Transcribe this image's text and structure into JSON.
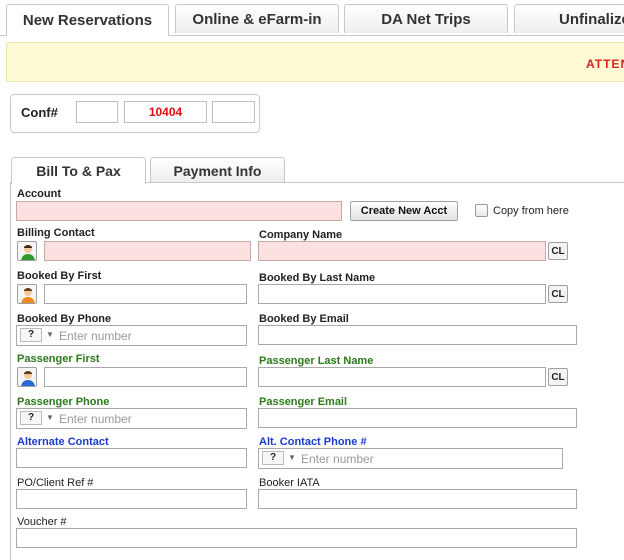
{
  "top_tabs": [
    {
      "label": "New Reservations",
      "active": true
    },
    {
      "label": "Online & eFarm-in",
      "active": false
    },
    {
      "label": "DA Net Trips",
      "active": false
    },
    {
      "label": "Unfinalize",
      "active": false
    }
  ],
  "alert": {
    "text": "ATTEN"
  },
  "conf": {
    "label": "Conf#",
    "field1": "",
    "number": "10404",
    "field3": ""
  },
  "sub_tabs": [
    {
      "label": "Bill To & Pax",
      "active": true
    },
    {
      "label": "Payment Info",
      "active": false
    }
  ],
  "form": {
    "account": {
      "label": "Account",
      "value": ""
    },
    "create_new_acct": "Create New Acct",
    "copy_from_here": "Copy from here",
    "billing_contact": {
      "label": "Billing Contact",
      "value": ""
    },
    "company_name": {
      "label": "Company Name",
      "value": ""
    },
    "booked_by_first": {
      "label": "Booked By First",
      "value": ""
    },
    "booked_by_last": {
      "label": "Booked By Last Name",
      "value": ""
    },
    "booked_by_phone": {
      "label": "Booked By Phone",
      "code": "?",
      "placeholder": "Enter number"
    },
    "booked_by_email": {
      "label": "Booked By Email",
      "value": ""
    },
    "passenger_first": {
      "label": "Passenger First",
      "value": ""
    },
    "passenger_last": {
      "label": "Passenger Last Name",
      "value": ""
    },
    "passenger_phone": {
      "label": "Passenger Phone",
      "code": "?",
      "placeholder": "Enter number"
    },
    "passenger_email": {
      "label": "Passenger Email",
      "value": ""
    },
    "alternate_contact": {
      "label": "Alternate Contact",
      "value": ""
    },
    "alt_contact_phone": {
      "label": "Alt. Contact Phone #",
      "code": "?",
      "placeholder": "Enter number"
    },
    "po_client_ref": {
      "label": "PO/Client Ref #",
      "value": ""
    },
    "booker_iata": {
      "label": "Booker IATA",
      "value": ""
    },
    "voucher": {
      "label": "Voucher #",
      "value": ""
    },
    "cl_label": "CL"
  },
  "colors": {
    "required_bg": "#fde0e0",
    "label_green": "#2a7a1a",
    "label_blue": "#1a3ad0",
    "alert_red": "#e02020"
  },
  "icons": {
    "billing": "person-green-icon",
    "booked_by": "person-orange-icon",
    "passenger": "person-blue-icon"
  }
}
